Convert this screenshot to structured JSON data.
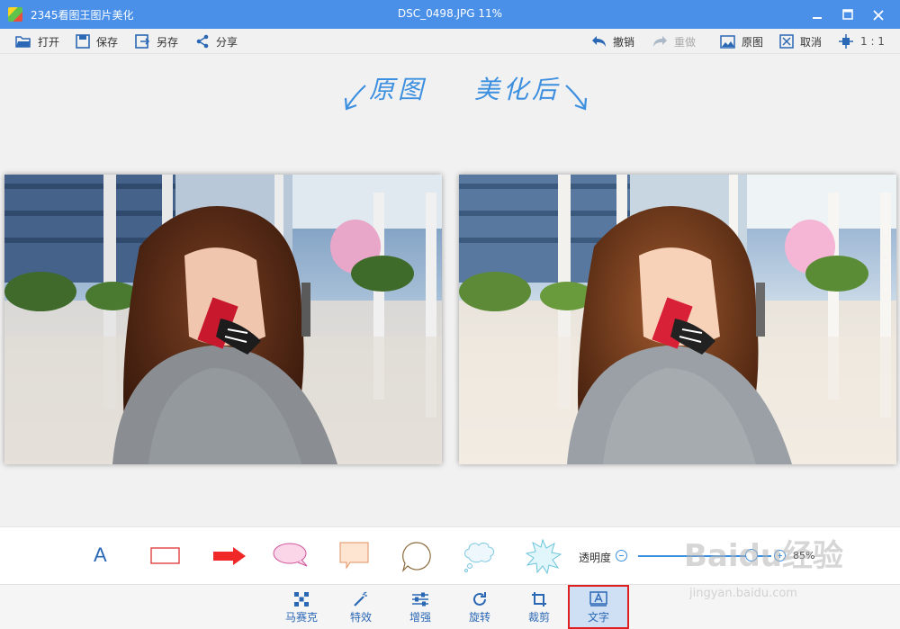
{
  "titlebar": {
    "app_title": "2345看图王图片美化",
    "doc_title": "DSC_0498.JPG   11%"
  },
  "toolbar": {
    "open": "打开",
    "save": "保存",
    "save_as": "另存",
    "share": "分享",
    "undo": "撤销",
    "redo": "重做",
    "original": "原图",
    "cancel": "取消",
    "ratio": "1 : 1"
  },
  "labels": {
    "original": "原图",
    "after": "美化后"
  },
  "shape_panel": {
    "text_glyph": "A",
    "opacity_label": "透明度",
    "opacity_value": "85%",
    "opacity_fraction": 0.85
  },
  "tools": {
    "mosaic": "马赛克",
    "effects": "特效",
    "enhance": "增强",
    "rotate": "旋转",
    "crop": "裁剪",
    "text": "文字"
  },
  "watermark": {
    "main": "Baidu经验",
    "url": "jingyan.baidu.com"
  },
  "colors": {
    "titlebar": "#4a90e8",
    "accent": "#3a8fe0",
    "highlight_border": "#e02020"
  }
}
